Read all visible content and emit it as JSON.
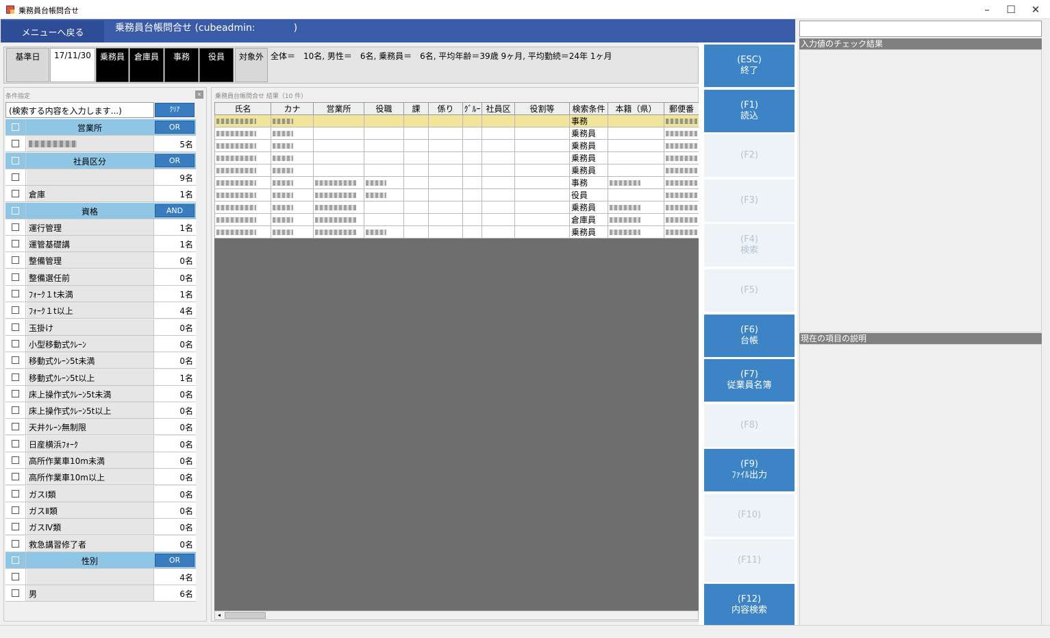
{
  "window": {
    "title": "乗務員台帳問合せ",
    "minimize": "–",
    "maximize": "☐",
    "close": "✕"
  },
  "header": {
    "menu_back": "メニューへ戻る",
    "title": "乗務員台帳問合せ (cubeadmin:　　　　)"
  },
  "criteria": {
    "base_date_label": "基準日",
    "base_date": "17/11/30",
    "btn_driver": "乗務員",
    "btn_warehouse": "倉庫員",
    "btn_office": "事務",
    "btn_officer": "役員",
    "btn_excluded": "対象外",
    "summary": "全体＝　10名, 男性＝　6名, 乗務員＝　6名, 平均年齢＝39歳 9ヶ月, 平均勤続＝24年 1ヶ月"
  },
  "left": {
    "caption": "条件指定",
    "close": "×",
    "search_placeholder": "(検索する内容を入力します...)",
    "clear": "ｸﾘｱ",
    "groups": {
      "office": {
        "label": "営業所",
        "mode": "OR"
      },
      "division": {
        "label": "社員区分",
        "mode": "OR"
      },
      "license": {
        "label": "資格",
        "mode": "AND"
      },
      "gender": {
        "label": "性別",
        "mode": "OR"
      }
    },
    "office_items": [
      {
        "label": "",
        "count": "5名"
      }
    ],
    "division_items": [
      {
        "label": "",
        "count": "9名"
      },
      {
        "label": "倉庫",
        "count": "1名"
      }
    ],
    "license_items": [
      {
        "label": "運行管理",
        "count": "1名"
      },
      {
        "label": "運管基礎講",
        "count": "1名"
      },
      {
        "label": "整備管理",
        "count": "0名"
      },
      {
        "label": "整備選任前",
        "count": "0名"
      },
      {
        "label": "ﾌｫｰｸ１t未満",
        "count": "1名"
      },
      {
        "label": "ﾌｫｰｸ１t以上",
        "count": "4名"
      },
      {
        "label": "玉掛け",
        "count": "0名"
      },
      {
        "label": "小型移動式ｸﾚｰﾝ",
        "count": "0名"
      },
      {
        "label": "移動式ｸﾚｰﾝ5t未満",
        "count": "0名"
      },
      {
        "label": "移動式ｸﾚｰﾝ5t以上",
        "count": "1名"
      },
      {
        "label": "床上操作式ｸﾚｰﾝ5t未満",
        "count": "0名"
      },
      {
        "label": "床上操作式ｸﾚｰﾝ5t以上",
        "count": "0名"
      },
      {
        "label": "天井ｸﾚｰﾝ無制限",
        "count": "0名"
      },
      {
        "label": "日産横浜ﾌｫｰｸ",
        "count": "0名"
      },
      {
        "label": "高所作業車10m未満",
        "count": "0名"
      },
      {
        "label": "高所作業車10m以上",
        "count": "0名"
      },
      {
        "label": "ガスⅠ類",
        "count": "0名"
      },
      {
        "label": "ガスⅡ類",
        "count": "0名"
      },
      {
        "label": "ガスⅣ類",
        "count": "0名"
      },
      {
        "label": "救急講習修了者",
        "count": "0名"
      }
    ],
    "gender_items": [
      {
        "label": "",
        "count": "4名"
      },
      {
        "label": "男",
        "count": "6名"
      }
    ]
  },
  "grid": {
    "caption": "乗務員台帳問合せ 結果（10 件）",
    "columns": [
      "氏名",
      "カナ",
      "営業所",
      "役職",
      "課",
      "係り",
      "ｸﾞﾙｰ",
      "社員区",
      "役割等",
      "検索条件",
      "本籍（県）",
      "郵便番"
    ],
    "rows": [
      {
        "cond": "事務",
        "office_blur": false,
        "pos_blur": false,
        "honseki_blur": false
      },
      {
        "cond": "乗務員",
        "office_blur": false,
        "pos_blur": false,
        "honseki_blur": false
      },
      {
        "cond": "乗務員",
        "office_blur": false,
        "pos_blur": false,
        "honseki_blur": false
      },
      {
        "cond": "乗務員",
        "office_blur": false,
        "pos_blur": false,
        "honseki_blur": false
      },
      {
        "cond": "乗務員",
        "office_blur": false,
        "pos_blur": false,
        "honseki_blur": false
      },
      {
        "cond": "事務",
        "office_blur": true,
        "pos_blur": true,
        "honseki_blur": true
      },
      {
        "cond": "役員",
        "office_blur": true,
        "pos_blur": true,
        "honseki_blur": false
      },
      {
        "cond": "乗務員",
        "office_blur": true,
        "pos_blur": false,
        "honseki_blur": true
      },
      {
        "cond": "倉庫員",
        "office_blur": true,
        "pos_blur": false,
        "honseki_blur": true
      },
      {
        "cond": "乗務員",
        "office_blur": true,
        "pos_blur": true,
        "honseki_blur": true
      }
    ],
    "scroll_left": "◂"
  },
  "fkeys": [
    {
      "key": "(ESC)",
      "label": "終了",
      "enabled": true
    },
    {
      "key": "(F1)",
      "label": "読込",
      "enabled": true
    },
    {
      "key": "(F2)",
      "label": "",
      "enabled": false
    },
    {
      "key": "(F3)",
      "label": "",
      "enabled": false
    },
    {
      "key": "(F4)",
      "label": "検索",
      "enabled": false
    },
    {
      "key": "(F5)",
      "label": "",
      "enabled": false
    },
    {
      "key": "(F6)",
      "label": "台帳",
      "enabled": true
    },
    {
      "key": "(F7)",
      "label": "従業員名簿",
      "enabled": true
    },
    {
      "key": "(F8)",
      "label": "",
      "enabled": false
    },
    {
      "key": "(F9)",
      "label": "ﾌｧｲﾙ出力",
      "enabled": true
    },
    {
      "key": "(F10)",
      "label": "",
      "enabled": false
    },
    {
      "key": "(F11)",
      "label": "",
      "enabled": false
    },
    {
      "key": "(F12)",
      "label": "内容検索",
      "enabled": true
    }
  ],
  "right": {
    "check_title": "入力値のチェック結果",
    "desc_title": "現在の項目の説明"
  },
  "colors": {
    "header": "#3a5ba8",
    "accent_button": "#3c84c6",
    "group_row": "#8fc6e6",
    "selected_row": "#f0e59a"
  }
}
